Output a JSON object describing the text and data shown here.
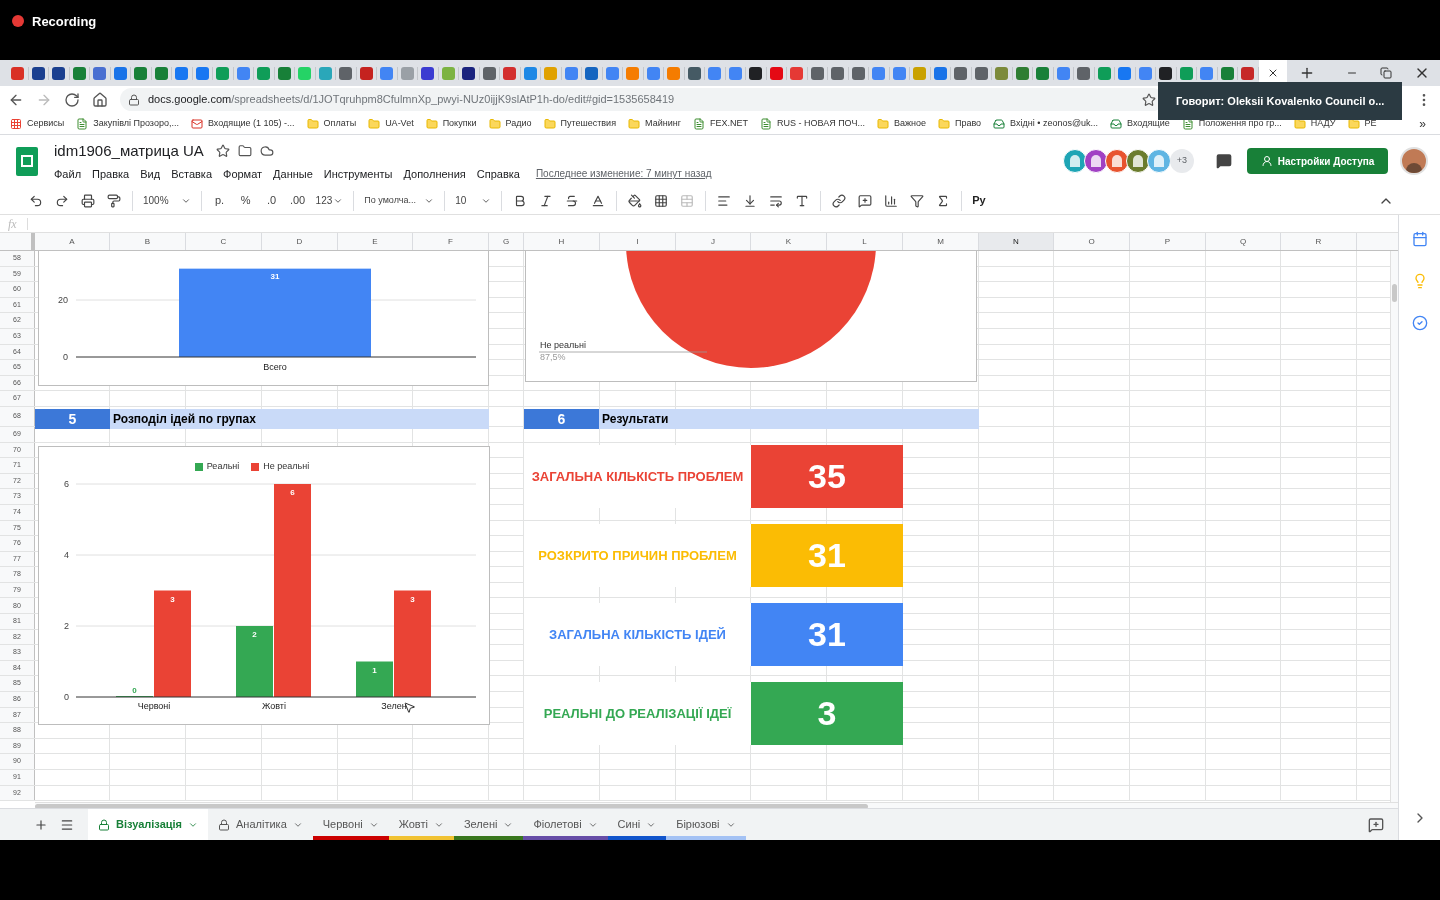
{
  "recording": {
    "label": "Recording"
  },
  "browser": {
    "url_host": "docs.google.com",
    "url_path": "/spreadsheets/d/1JOTqruhpm8CfulmnXp_pwyi-NUz0ijjK9slAtP1h-do/edit#gid=1535658419",
    "tooltip": "Говорит: Oleksii Kovalenko Council o...",
    "bookmarks": [
      {
        "kind": "apps",
        "label": "Сервисы"
      },
      {
        "kind": "site",
        "label": "Закупівлі Прозоро,..."
      },
      {
        "kind": "mail",
        "label": "Входящие (1 105) -..."
      },
      {
        "kind": "folder",
        "label": "Оплаты"
      },
      {
        "kind": "folder",
        "label": "UA-Vet"
      },
      {
        "kind": "folder",
        "label": "Покупки"
      },
      {
        "kind": "folder",
        "label": "Радио"
      },
      {
        "kind": "folder",
        "label": "Путешествия"
      },
      {
        "kind": "folder",
        "label": "Майнинг"
      },
      {
        "kind": "site",
        "label": "FEX.NET"
      },
      {
        "kind": "site",
        "label": "RUS - НОВАЯ ПОЧ..."
      },
      {
        "kind": "folder",
        "label": "Важное"
      },
      {
        "kind": "folder",
        "label": "Право"
      },
      {
        "kind": "inbox",
        "label": "Вхідні • zeonos@uk..."
      },
      {
        "kind": "inbox",
        "label": "Входящие"
      },
      {
        "kind": "site",
        "label": "Положення про гр..."
      },
      {
        "kind": "folder",
        "label": "НАДУ"
      },
      {
        "kind": "folder",
        "label": "РЕ"
      }
    ],
    "more_bookmarks": "»"
  },
  "doc": {
    "title": "idm1906_матрица UA",
    "menus": [
      "Файл",
      "Правка",
      "Вид",
      "Вставка",
      "Формат",
      "Данные",
      "Инструменты",
      "Дополнения",
      "Справка"
    ],
    "last_edit": "Последнее изменение: 7 минут назад",
    "collaborators": [
      {
        "color": "#1ea5b5"
      },
      {
        "color": "#a141c4"
      },
      {
        "color": "#e8532f"
      },
      {
        "color": "#6b7c2d"
      },
      {
        "color": "#5fb5e3"
      }
    ],
    "more_collaborators": "+3",
    "share_label": "Настройки Доступа"
  },
  "toolbar": {
    "zoom": "100%",
    "currency": "р.",
    "percent": "%",
    "decrease_decimals": ".0",
    "increase_decimals": ".00",
    "number_format": "123",
    "font": "По умолча...",
    "font_size": "10",
    "input_tools": "Ру"
  },
  "formula_bar": {
    "fx": "fx"
  },
  "columns": [
    {
      "label": "A",
      "selected": false
    },
    {
      "label": "B",
      "selected": false
    },
    {
      "label": "C",
      "selected": false
    },
    {
      "label": "D",
      "selected": false
    },
    {
      "label": "E",
      "selected": false
    },
    {
      "label": "F",
      "selected": false
    },
    {
      "label": "G",
      "selected": false
    },
    {
      "label": "H",
      "selected": false
    },
    {
      "label": "I",
      "selected": false
    },
    {
      "label": "J",
      "selected": false
    },
    {
      "label": "K",
      "selected": false
    },
    {
      "label": "L",
      "selected": false
    },
    {
      "label": "M",
      "selected": false
    },
    {
      "label": "N",
      "selected": true
    },
    {
      "label": "O",
      "selected": false
    },
    {
      "label": "P",
      "selected": false
    },
    {
      "label": "Q",
      "selected": false
    },
    {
      "label": "R",
      "selected": false
    }
  ],
  "rows": [
    "58",
    "59",
    "60",
    "61",
    "62",
    "63",
    "64",
    "65",
    "66",
    "67",
    "68",
    "69",
    "70",
    "71",
    "72",
    "73",
    "74",
    "75",
    "76",
    "77",
    "78",
    "79",
    "80",
    "81",
    "82",
    "83",
    "84",
    "85",
    "86",
    "87",
    "88",
    "89",
    "90",
    "91",
    "92"
  ],
  "total_chart": {
    "chart_data": {
      "type": "bar",
      "categories": [
        "Всего"
      ],
      "values": [
        31
      ],
      "ylim": [
        0,
        37
      ],
      "yticks": [
        0,
        20
      ],
      "data_labels": true
    }
  },
  "pie_chart": {
    "label": "Не реальні",
    "percent": "87,5%"
  },
  "sections": [
    {
      "number": "5",
      "title": "Розподіл ідей по групах"
    },
    {
      "number": "6",
      "title": "Результати"
    }
  ],
  "groups_chart": {
    "chart_data": {
      "type": "bar",
      "categories": [
        "Червоні",
        "Жовті",
        "Зелен"
      ],
      "series": [
        {
          "name": "Реальні",
          "color": "#34a853",
          "values": [
            0,
            2,
            1
          ]
        },
        {
          "name": "Не реальні",
          "color": "#ea4335",
          "values": [
            3,
            6,
            3
          ]
        }
      ],
      "ylim": [
        0,
        6
      ],
      "yticks": [
        0,
        2,
        4,
        6
      ],
      "legend": "top",
      "data_labels": true
    }
  },
  "results": [
    {
      "label": "ЗАГАЛЬНА КІЛЬКІСТЬ ПРОБЛЕМ",
      "value": "35",
      "color": "#ea4335"
    },
    {
      "label": "РОЗКРИТО ПРИЧИН ПРОБЛЕМ",
      "value": "31",
      "color": "#fbbc04"
    },
    {
      "label": "ЗАГАЛЬНА КІЛЬКІСТЬ ІДЕЙ",
      "value": "31",
      "color": "#4285f4"
    },
    {
      "label": "РЕАЛЬНІ ДО РЕАЛІЗАЦІЇ ІДЕЇ",
      "value": "3",
      "color": "#34a853"
    }
  ],
  "sheet_tabs": [
    {
      "label": "Візуалізація",
      "selected": true,
      "locked": true
    },
    {
      "label": "Аналітика",
      "selected": false,
      "locked": true
    },
    {
      "label": "Червоні",
      "selected": false,
      "locked": false,
      "color": "#cc0000"
    },
    {
      "label": "Жовті",
      "selected": false,
      "locked": false,
      "color": "#f1c232"
    },
    {
      "label": "Зелені",
      "selected": false,
      "locked": false,
      "color": "#38761d"
    },
    {
      "label": "Фіолетові",
      "selected": false,
      "locked": false,
      "color": "#674ea7"
    },
    {
      "label": "Сині",
      "selected": false,
      "locked": false,
      "color": "#1155cc"
    },
    {
      "label": "Бірюзові",
      "selected": false,
      "locked": false,
      "color": "#a4c2f4"
    }
  ]
}
